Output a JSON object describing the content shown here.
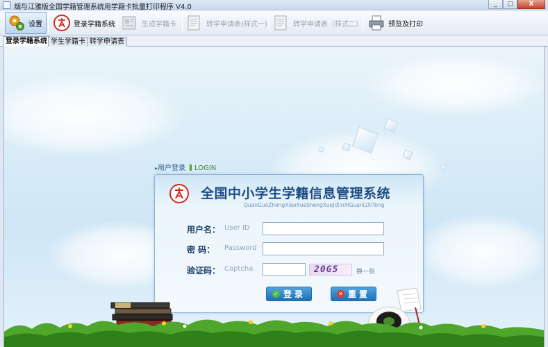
{
  "window": {
    "title": "烟与江雅版全国学籍管理系统用学籍卡批量打印程序 V4.0",
    "buttons": [
      "_",
      "□",
      "X"
    ]
  },
  "toolbar": {
    "items": [
      {
        "label": "设置",
        "icon": "gear-icon",
        "state": "active"
      },
      {
        "label": "登录学籍系统",
        "icon": "logo-icon",
        "state": "enabled"
      },
      {
        "label": "生成学籍卡",
        "icon": "card-icon",
        "state": "disabled"
      },
      {
        "label": "转学申请表(样式一)",
        "icon": "document-icon",
        "state": "disabled"
      },
      {
        "label": "转学申请表（样式二）",
        "icon": "document-icon",
        "state": "disabled"
      },
      {
        "label": "预览及打印",
        "icon": "printer-icon",
        "state": "enabled"
      }
    ]
  },
  "tabs": [
    "登录学籍系统",
    "学生学籍卡",
    "转学申请表"
  ],
  "active_tab": 0,
  "login": {
    "section_label": "用户登录",
    "section_label_en": "LOGIN",
    "system_title": "全国中小学生学籍信息管理系统",
    "system_subtitle": "QuanGuoZhongXiaoXueShengXueJiXinXiGuanLiXiTong",
    "username_label": "用户名：",
    "username_hint": "User ID",
    "username_value": "",
    "password_label": "密  码：",
    "password_hint": "Password",
    "password_value": "",
    "captcha_label": "验证码：",
    "captcha_hint": "Captcha",
    "captcha_value": "",
    "captcha_text": "20G5",
    "refresh_label": "换一张",
    "login_button": "登录",
    "reset_button": "重置"
  },
  "colors": {
    "accent": "#1e70b5",
    "title": "#1d4c86",
    "logo_red": "#d02b20",
    "login_green": "#3f8a2a"
  }
}
